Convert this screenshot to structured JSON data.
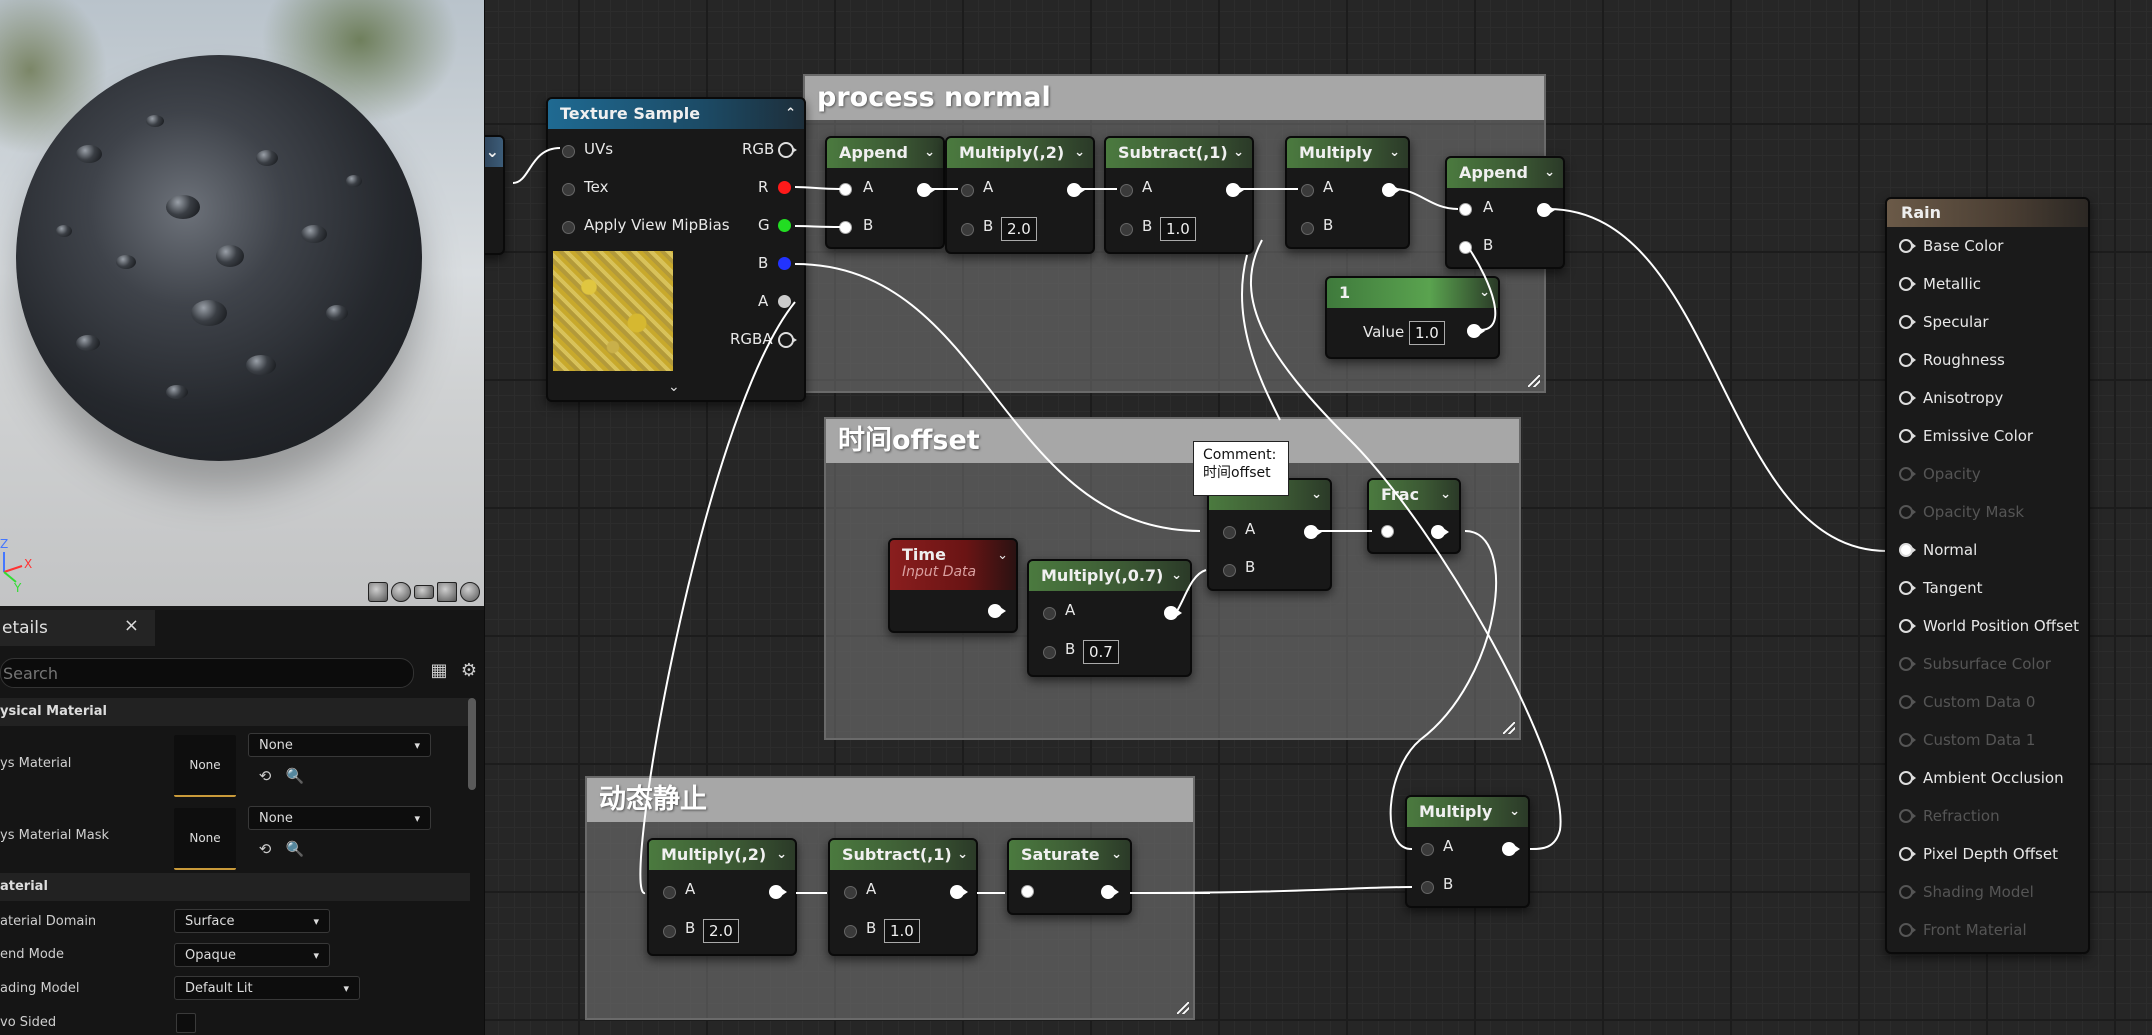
{
  "viewport": {
    "axis_labels": {
      "z": "Z",
      "x": "X",
      "y": "Y"
    }
  },
  "details": {
    "tab_title": "etails",
    "close_glyph": "×",
    "search_placeholder": "Search",
    "sections": {
      "physical_material": "ysical Material",
      "material": "aterial"
    },
    "phys_material": {
      "label": "ys Material",
      "thumb": "None",
      "value": "None"
    },
    "phys_material_mask": {
      "label": "ys Material Mask",
      "thumb": "None",
      "value": "None"
    },
    "material_domain": {
      "label": "aterial Domain",
      "value": "Surface"
    },
    "blend_mode": {
      "label": "end Mode",
      "value": "Opaque"
    },
    "shading_model": {
      "label": "ading Model",
      "value": "Default Lit"
    },
    "two_sided": {
      "label": "vo Sided",
      "checked": false
    }
  },
  "comments": {
    "process_normal": "process normal",
    "time_offset": "时间offset",
    "dynamic_static": "动态静止"
  },
  "texture_sample": {
    "title": "Texture Sample",
    "inputs": [
      "UVs",
      "Tex",
      "Apply View MipBias"
    ],
    "outputs": [
      "RGB",
      "R",
      "G",
      "B",
      "A",
      "RGBA"
    ]
  },
  "nodes": {
    "append1": {
      "title": "Append",
      "a": "A",
      "b": "B"
    },
    "multiply2": {
      "title": "Multiply(,2)",
      "a": "A",
      "b": "B",
      "b_value": "2.0"
    },
    "subtract1": {
      "title": "Subtract(,1)",
      "a": "A",
      "b": "B",
      "b_value": "1.0"
    },
    "multiply_top": {
      "title": "Multiply",
      "a": "A",
      "b": "B"
    },
    "append2": {
      "title": "Append",
      "a": "A",
      "b": "B"
    },
    "const1": {
      "title": "1",
      "label": "Value",
      "value": "1.0"
    },
    "time": {
      "title": "Time",
      "subtitle": "Input Data"
    },
    "multiply07": {
      "title": "Multiply(,0.7)",
      "a": "A",
      "b": "B",
      "b_value": "0.7"
    },
    "add_node": {
      "a": "A",
      "b": "B"
    },
    "frac": {
      "title": "Frac"
    },
    "multiply_bottom2": {
      "title": "Multiply(,2)",
      "a": "A",
      "b": "B",
      "b_value": "2.0"
    },
    "subtract_bottom": {
      "title": "Subtract(,1)",
      "a": "A",
      "b": "B",
      "b_value": "1.0"
    },
    "saturate": {
      "title": "Saturate"
    },
    "multiply_final": {
      "title": "Multiply",
      "a": "A",
      "b": "B"
    }
  },
  "tooltip": {
    "line1": "Comment:",
    "line2": "时间offset"
  },
  "material_node": {
    "title": "Rain",
    "inputs": [
      {
        "label": "Base Color",
        "enabled": true
      },
      {
        "label": "Metallic",
        "enabled": true
      },
      {
        "label": "Specular",
        "enabled": true
      },
      {
        "label": "Roughness",
        "enabled": true
      },
      {
        "label": "Anisotropy",
        "enabled": true
      },
      {
        "label": "Emissive Color",
        "enabled": true
      },
      {
        "label": "Opacity",
        "enabled": false
      },
      {
        "label": "Opacity Mask",
        "enabled": false
      },
      {
        "label": "Normal",
        "enabled": true,
        "connected": true
      },
      {
        "label": "Tangent",
        "enabled": true
      },
      {
        "label": "World Position Offset",
        "enabled": true
      },
      {
        "label": "Subsurface Color",
        "enabled": false
      },
      {
        "label": "Custom Data 0",
        "enabled": false
      },
      {
        "label": "Custom Data 1",
        "enabled": false
      },
      {
        "label": "Ambient Occlusion",
        "enabled": true
      },
      {
        "label": "Refraction",
        "enabled": false
      },
      {
        "label": "Pixel Depth Offset",
        "enabled": true
      },
      {
        "label": "Shading Model",
        "enabled": false
      },
      {
        "label": "Front Material",
        "enabled": false
      }
    ]
  },
  "colors": {
    "pin_r": "#ff1a1a",
    "pin_g": "#22dd22",
    "pin_b": "#2233ff",
    "pin_a": "#cccccc",
    "accent_thumb": "#c99a3a"
  }
}
